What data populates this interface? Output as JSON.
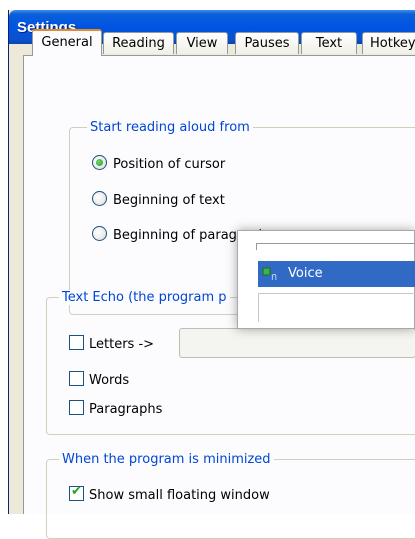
{
  "window": {
    "title": "Settings"
  },
  "tabs": [
    {
      "label": "General",
      "active": true
    },
    {
      "label": "Reading"
    },
    {
      "label": "View"
    },
    {
      "label": "Pauses"
    },
    {
      "label": "Text"
    },
    {
      "label": "Hotkey"
    }
  ],
  "start_reading": {
    "legend": "Start reading aloud from",
    "options": [
      {
        "label": "Position of cursor",
        "checked": true
      },
      {
        "label": "Beginning of text",
        "checked": false
      },
      {
        "label": "Beginning of paragraph",
        "checked": false
      }
    ]
  },
  "text_echo": {
    "legend": "Text Echo (the program p",
    "options": [
      {
        "label": "Letters ->",
        "checked": false
      },
      {
        "label": "Words",
        "checked": false
      },
      {
        "label": "Paragraphs",
        "checked": false
      }
    ]
  },
  "minimized": {
    "legend": "When the program is minimized",
    "options": [
      {
        "label": "Show small floating window",
        "checked": true
      }
    ]
  },
  "popup_menu": {
    "selected_item": "Voice",
    "selected_icon": "voice-icon",
    "highlight_color": "#316ac5"
  }
}
